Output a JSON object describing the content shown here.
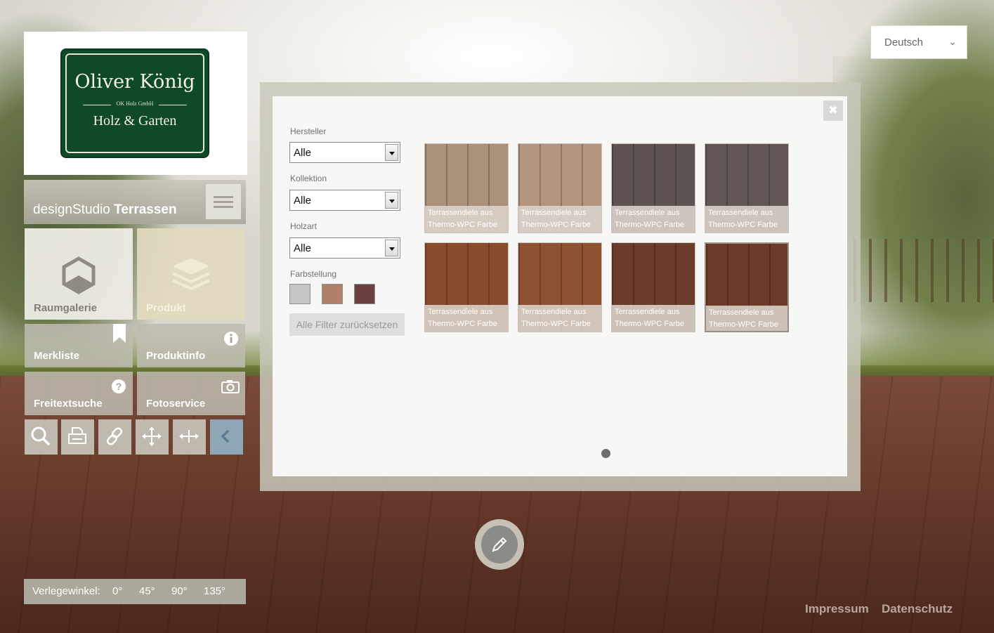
{
  "logo": {
    "name": "Oliver König",
    "subline": "OK Holz GmbH",
    "tagline": "Holz & Garten"
  },
  "language": {
    "selected": "Deutsch"
  },
  "studio": {
    "title_light": "designStudio",
    "title_bold": "Terrassen"
  },
  "tiles": {
    "raumgalerie": "Raumgalerie",
    "produkt": "Produkt",
    "merkliste": "Merkliste",
    "produktinfo": "Produktinfo",
    "freitextsuche": "Freitextsuche",
    "fotoservice": "Fotoservice"
  },
  "tools": [
    "search-icon",
    "print-icon",
    "link-icon",
    "move-icon",
    "resize-horizontal-icon",
    "collapse-left-icon"
  ],
  "angle": {
    "label": "Verlegewinkel:",
    "options": [
      "0°",
      "45°",
      "90°",
      "135°"
    ]
  },
  "filters": {
    "hersteller": {
      "label": "Hersteller",
      "value": "Alle"
    },
    "kollektion": {
      "label": "Kollektion",
      "value": "Alle"
    },
    "holzart": {
      "label": "Holzart",
      "value": "Alle"
    },
    "farbstellung": {
      "label": "Farbstellung",
      "swatches": [
        "#c6c5c3",
        "#b08068",
        "#6a4140"
      ]
    },
    "reset_label": "Alle Filter zurücksetzen"
  },
  "products": [
    {
      "caption": "Terrassendiele aus Thermo-WPC Farbe sand -",
      "color": "#ab9179"
    },
    {
      "caption": "Terrassendiele aus Thermo-WPC Farbe sand -",
      "color": "#b39580"
    },
    {
      "caption": "Terrassendiele aus Thermo-WPC Farbe grau -",
      "color": "#5f5351"
    },
    {
      "caption": "Terrassendiele aus Thermo-WPC Farbe grau -",
      "color": "#625655"
    },
    {
      "caption": "Terrassendiele aus Thermo-WPC Farbe zeder -",
      "color": "#8a4b2c"
    },
    {
      "caption": "Terrassendiele aus Thermo-WPC Farbe zeder -",
      "color": "#8d5232"
    },
    {
      "caption": "Terrassendiele aus Thermo-WPC Farbe walnus",
      "color": "#6c3b2b"
    },
    {
      "caption": "Terrassendiele aus Thermo-WPC Farbe walnu",
      "color": "#6b3a28"
    }
  ],
  "footer": {
    "impressum": "Impressum",
    "datenschutz": "Datenschutz"
  }
}
